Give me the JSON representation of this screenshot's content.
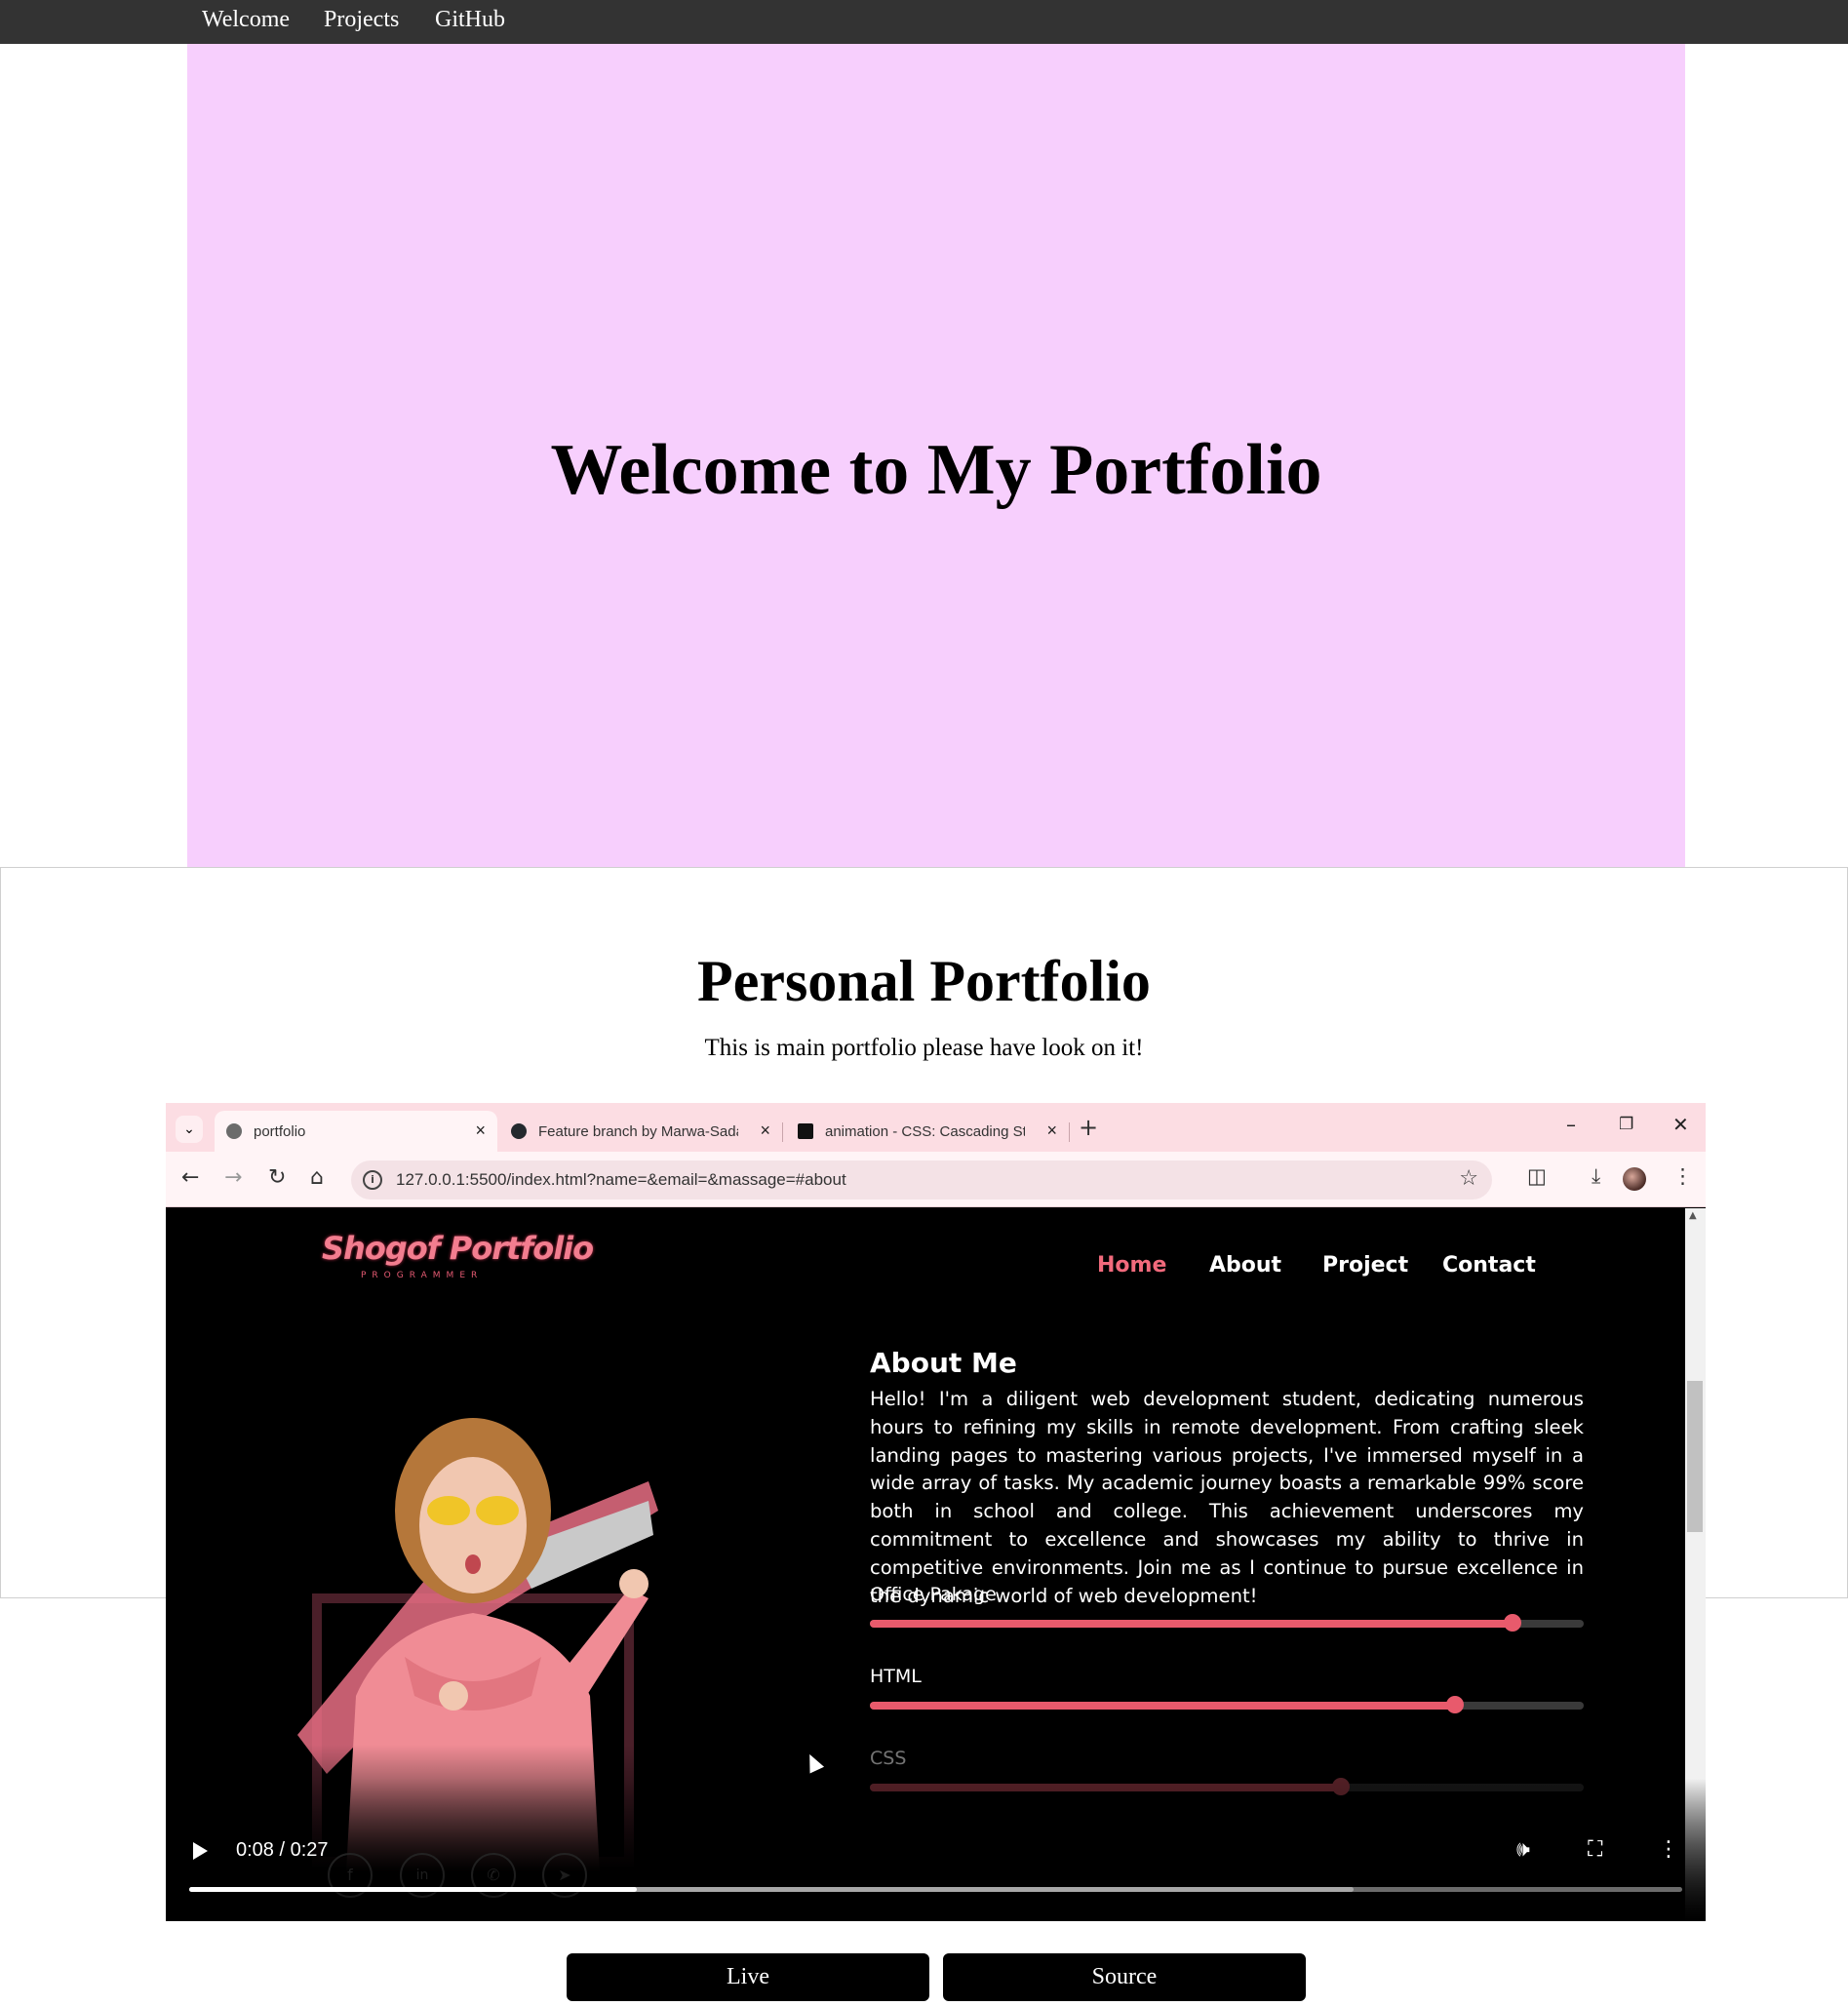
{
  "nav": {
    "items": [
      "Welcome",
      "Projects",
      "GitHub"
    ]
  },
  "hero": {
    "title": "Welcome to My Portfolio",
    "bg_color": "#f7cffd"
  },
  "section": {
    "title": "Personal Portfolio",
    "subtitle": "This is main portfolio please have look on it!"
  },
  "video": {
    "browser": {
      "tabs": [
        {
          "label": "portfolio",
          "icon": "globe-icon",
          "active": true
        },
        {
          "label": "Feature branch by Marwa-Sadat",
          "icon": "github-icon",
          "active": false
        },
        {
          "label": "animation - CSS: Cascading Style",
          "icon": "mdn-icon",
          "active": false
        }
      ],
      "url": "127.0.0.1:5500/index.html?name=&email=&massage=#about"
    },
    "site": {
      "logo": "Shogof Portfolio",
      "logo_sub": "PROGRAMMER",
      "nav": [
        "Home",
        "About",
        "Project",
        "Contact"
      ],
      "about_title": "About Me",
      "about_text": "Hello! I'm a diligent web development student, dedicating numerous hours to refining my skills in remote development. From crafting sleek landing pages to mastering various projects, I've immersed myself in a wide array of tasks. My academic journey boasts a remarkable 99% score both in school and college. This achievement underscores my commitment to excellence and showcases my ability to thrive in competitive environments. Join me as I continue to pursue excellence in the dynamic world of web development!",
      "skills": [
        {
          "name": "Office Pakage",
          "level": 0.9
        },
        {
          "name": "HTML",
          "level": 0.82
        },
        {
          "name": "CSS",
          "level": 0.66
        }
      ],
      "accent_color": "#e85a6c"
    },
    "player": {
      "time": "0:08 / 0:27",
      "played": 0.3,
      "buffered": 0.78
    }
  },
  "buttons": {
    "live": "Live",
    "source": "Source"
  }
}
